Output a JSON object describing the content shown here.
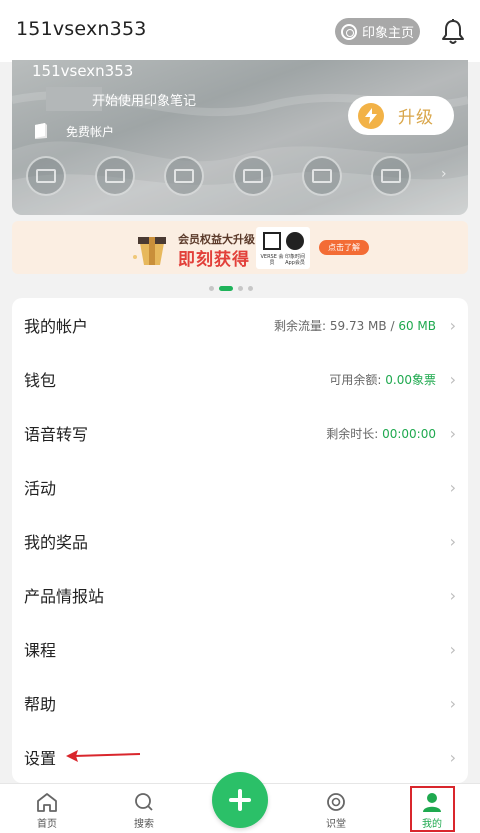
{
  "header": {
    "username": "151vsexn353",
    "home_label": "印象主页"
  },
  "banner": {
    "username": "151vsexn353",
    "slogan": "开始使用印象笔记",
    "account_type": "免费帐户",
    "upgrade_label": "升级",
    "feature_icons": [
      "feature-icon-1",
      "feature-icon-2",
      "feature-icon-3",
      "feature-icon-4",
      "feature-icon-5",
      "feature-icon-6"
    ]
  },
  "ad": {
    "line1": "会员权益大升级",
    "line2": "即刻获得",
    "brand1_caption": "VERSE 会员",
    "brand2_caption": "印象时间 App会员",
    "cta": "点击了解"
  },
  "carousel": {
    "page_count": 4,
    "active_index": 1
  },
  "menu": {
    "items": [
      {
        "label": "我的帐户",
        "value_prefix": "剩余流量:  59.73 MB / ",
        "value_highlight": "60 MB"
      },
      {
        "label": "钱包",
        "value_prefix": "可用余额:  ",
        "value_highlight": "0.00象票"
      },
      {
        "label": "语音转写",
        "value_prefix": "剩余时长:   ",
        "value_highlight": "00:00:00"
      },
      {
        "label": "活动",
        "value_prefix": "",
        "value_highlight": ""
      },
      {
        "label": "我的奖品",
        "value_prefix": "",
        "value_highlight": ""
      },
      {
        "label": "产品情报站",
        "value_prefix": "",
        "value_highlight": ""
      },
      {
        "label": "课程",
        "value_prefix": "",
        "value_highlight": ""
      },
      {
        "label": "帮助",
        "value_prefix": "",
        "value_highlight": ""
      },
      {
        "label": "设置",
        "value_prefix": "",
        "value_highlight": ""
      }
    ]
  },
  "nav": {
    "home": "首页",
    "search": "搜索",
    "learn": "识堂",
    "me": "我的"
  },
  "colors": {
    "accent_green": "#1fa94f",
    "fab_green": "#2bc068",
    "annotation_red": "#d9262c",
    "upgrade_gold": "#f2b247"
  }
}
